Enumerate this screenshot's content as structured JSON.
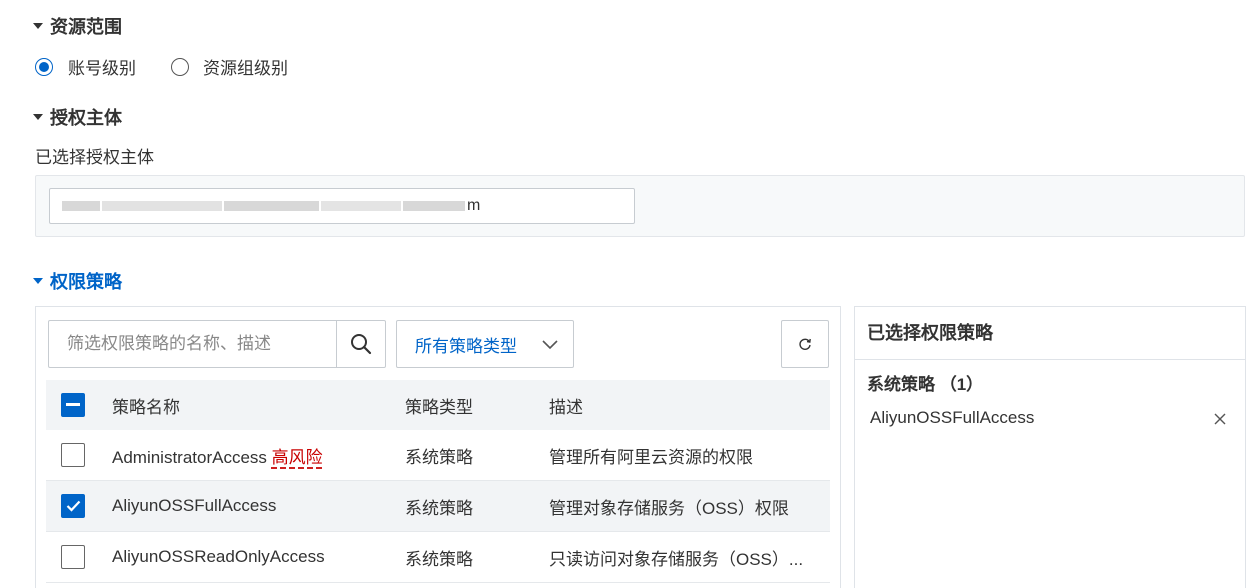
{
  "resource_scope": {
    "title": "资源范围",
    "options": [
      {
        "label": "账号级别",
        "checked": true
      },
      {
        "label": "资源组级别",
        "checked": false
      }
    ]
  },
  "principal": {
    "title": "授权主体",
    "selected_label": "已选择授权主体",
    "value_tail": "m"
  },
  "policy": {
    "title": "权限策略",
    "search_placeholder": "筛选权限策略的名称、描述",
    "type_filter": "所有策略类型",
    "columns": {
      "name": "策略名称",
      "type": "策略类型",
      "desc": "描述"
    },
    "rows": [
      {
        "name": "AdministratorAccess",
        "risk": "高风险",
        "type": "系统策略",
        "desc": "管理所有阿里云资源的权限",
        "checked": false
      },
      {
        "name": "AliyunOSSFullAccess",
        "risk": "",
        "type": "系统策略",
        "desc": "管理对象存储服务（OSS）权限",
        "checked": true
      },
      {
        "name": "AliyunOSSReadOnlyAccess",
        "risk": "",
        "type": "系统策略",
        "desc": "只读访问对象存储服务（OSS）...",
        "checked": false
      }
    ]
  },
  "selected_panel": {
    "title": "已选择权限策略",
    "group_label": "系统策略 （1）",
    "items": [
      "AliyunOSSFullAccess"
    ]
  },
  "colors": {
    "accent": "#0064c8",
    "risk": "#c80000"
  },
  "icons": [
    "search-icon",
    "chevron-down-icon",
    "refresh-icon",
    "close-icon",
    "caret-down-icon"
  ]
}
